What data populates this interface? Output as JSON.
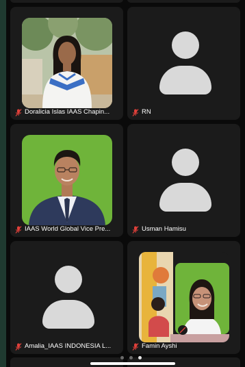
{
  "participants": [
    {
      "name": "Doralicia Islas IAAS Chapin...",
      "muted": true,
      "video": "photo"
    },
    {
      "name": "RN",
      "muted": true,
      "video": "avatar"
    },
    {
      "name": "IAAS World Global Vice Pre...",
      "muted": true,
      "video": "photo"
    },
    {
      "name": "Usman Hamisu",
      "muted": true,
      "video": "avatar"
    },
    {
      "name": "Amalia_IAAS INDONESIA L...",
      "muted": true,
      "video": "avatar"
    },
    {
      "name": "Famin Ayshi",
      "muted": true,
      "video": "photo"
    }
  ],
  "pagination": {
    "pages": 3,
    "current": 3
  },
  "colors": {
    "tile_bg": "#1b1b1b",
    "screen_bg": "#0a0a0a",
    "muted_icon": "#e0403a",
    "avatar": "#d9d9d9",
    "green_screen": "#6fb43a"
  },
  "icons": {
    "muted": "microphone-slash-icon",
    "placeholder": "person-avatar-icon"
  }
}
